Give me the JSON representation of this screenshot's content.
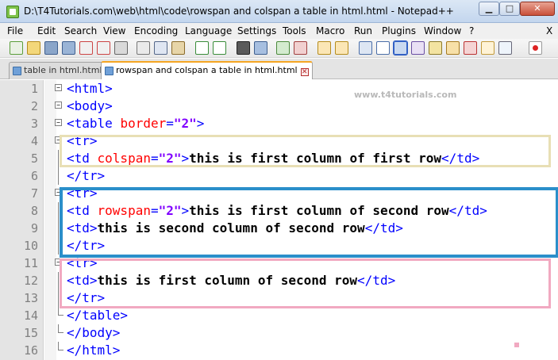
{
  "window": {
    "title": "D:\\T4Tutorials.com\\web\\html\\code\\rowspan and colspan a table in html.html - Notepad++",
    "minimize_label": "▁",
    "maximize_label": "□",
    "close_label": "✕"
  },
  "menu": {
    "items": [
      "File",
      "Edit",
      "Search",
      "View",
      "Encoding",
      "Language",
      "Settings",
      "Tools",
      "Macro",
      "Run",
      "Plugins",
      "Window",
      "?"
    ],
    "close_label": "X"
  },
  "toolbar": {
    "icons": [
      "new-file-icon",
      "open-file-icon",
      "save-icon",
      "save-all-icon",
      "close-icon",
      "close-all-icon",
      "print-icon",
      "cut-icon",
      "copy-icon",
      "paste-icon",
      "undo-icon",
      "redo-icon",
      "find-icon",
      "replace-icon",
      "zoom-in-icon",
      "zoom-out-icon",
      "sync-v-icon",
      "sync-h-icon",
      "word-wrap-icon",
      "show-all-chars-icon",
      "indent-guide-icon",
      "user-lang-icon",
      "function-list-icon",
      "folder-as-workspace-icon",
      "doc-map-icon",
      "monitoring-icon",
      "record-macro-icon"
    ]
  },
  "tabs": [
    {
      "label": "table in html.html",
      "active": false,
      "close": "✕"
    },
    {
      "label": "rowspan and colspan a table in html.html",
      "active": true,
      "close": "✕"
    }
  ],
  "editor": {
    "watermark": "www.t4tutorials.com",
    "lines": [
      {
        "num": "1",
        "tokens": [
          {
            "t": "tag",
            "v": "<html>"
          }
        ]
      },
      {
        "num": "2",
        "tokens": [
          {
            "t": "tag",
            "v": "<body>"
          }
        ]
      },
      {
        "num": "3",
        "tokens": [
          {
            "t": "tag",
            "v": "<table "
          },
          {
            "t": "attr",
            "v": "border"
          },
          {
            "t": "tag",
            "v": "="
          },
          {
            "t": "val",
            "v": "\"2\""
          },
          {
            "t": "tag",
            "v": ">"
          }
        ]
      },
      {
        "num": "4",
        "tokens": [
          {
            "t": "tag",
            "v": "<tr>"
          }
        ]
      },
      {
        "num": "5",
        "tokens": [
          {
            "t": "tag",
            "v": "<td "
          },
          {
            "t": "attr",
            "v": "colspan"
          },
          {
            "t": "tag",
            "v": "="
          },
          {
            "t": "val",
            "v": "\"2\""
          },
          {
            "t": "tag",
            "v": ">"
          },
          {
            "t": "txt",
            "v": "this is first column of first row"
          },
          {
            "t": "tag",
            "v": "</td>"
          }
        ]
      },
      {
        "num": "6",
        "tokens": [
          {
            "t": "tag",
            "v": "</tr>"
          }
        ]
      },
      {
        "num": "7",
        "tokens": [
          {
            "t": "tag",
            "v": "<tr>"
          }
        ]
      },
      {
        "num": "8",
        "tokens": [
          {
            "t": "tag",
            "v": "<td "
          },
          {
            "t": "attr",
            "v": "rowspan"
          },
          {
            "t": "tag",
            "v": "="
          },
          {
            "t": "val",
            "v": "\"2\""
          },
          {
            "t": "tag",
            "v": ">"
          },
          {
            "t": "txt",
            "v": "this is first column of second row"
          },
          {
            "t": "tag",
            "v": "</td>"
          }
        ]
      },
      {
        "num": "9",
        "tokens": [
          {
            "t": "tag",
            "v": "<td>"
          },
          {
            "t": "txt",
            "v": "this is second column of second row"
          },
          {
            "t": "tag",
            "v": "</td>"
          }
        ]
      },
      {
        "num": "10",
        "tokens": [
          {
            "t": "tag",
            "v": "</tr>"
          }
        ]
      },
      {
        "num": "11",
        "tokens": [
          {
            "t": "tag",
            "v": "<tr>"
          }
        ]
      },
      {
        "num": "12",
        "tokens": [
          {
            "t": "tag",
            "v": "<td>"
          },
          {
            "t": "txt",
            "v": "this is first column of second row"
          },
          {
            "t": "tag",
            "v": "</td>"
          }
        ]
      },
      {
        "num": "13",
        "tokens": [
          {
            "t": "tag",
            "v": "</tr>"
          }
        ]
      },
      {
        "num": "14",
        "tokens": [
          {
            "t": "tag",
            "v": "</table>"
          }
        ]
      },
      {
        "num": "15",
        "tokens": [
          {
            "t": "tag",
            "v": "</body>"
          }
        ]
      },
      {
        "num": "16",
        "tokens": [
          {
            "t": "tag",
            "v": "</html>"
          }
        ]
      }
    ]
  },
  "colors": {
    "tag": "#0000ff",
    "attribute": "#ff0000",
    "value": "#8000ff",
    "highlight_yellow": "#e8dfb5",
    "highlight_blue": "#2b8fca",
    "highlight_pink": "#f1a9c1"
  }
}
